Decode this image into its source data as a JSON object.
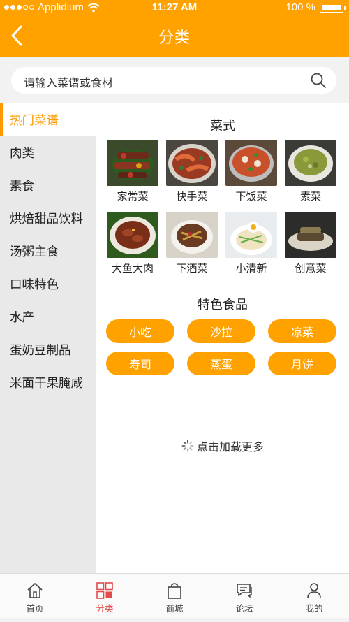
{
  "status_bar": {
    "carrier": "Applidium",
    "time": "11:27 AM",
    "battery": "100 %"
  },
  "nav": {
    "title": "分类"
  },
  "search": {
    "placeholder": "请输入菜谱或食材"
  },
  "sidebar": {
    "items": [
      {
        "label": "热门菜谱",
        "active": true
      },
      {
        "label": "肉类"
      },
      {
        "label": "素食"
      },
      {
        "label": "烘焙甜品饮料"
      },
      {
        "label": "汤粥主食"
      },
      {
        "label": "口味特色"
      },
      {
        "label": "水产"
      },
      {
        "label": "蛋奶豆制品"
      },
      {
        "label": "米面干果腌咸"
      }
    ]
  },
  "content": {
    "cuisine_title": "菜式",
    "cuisines": [
      {
        "label": "家常菜",
        "icon": "skewer-dish-photo"
      },
      {
        "label": "快手菜",
        "icon": "shrimp-dish-photo"
      },
      {
        "label": "下饭菜",
        "icon": "hotpot-photo"
      },
      {
        "label": "素菜",
        "icon": "vegetable-dish-photo"
      },
      {
        "label": "大鱼大肉",
        "icon": "braised-meat-photo"
      },
      {
        "label": "下酒菜",
        "icon": "snack-dish-photo"
      },
      {
        "label": "小清新",
        "icon": "noodle-egg-photo"
      },
      {
        "label": "创意菜",
        "icon": "creative-dish-photo"
      }
    ],
    "special_title": "特色食品",
    "specials": [
      "小吃",
      "沙拉",
      "凉菜",
      "寿司",
      "蒸蛋",
      "月饼"
    ],
    "load_more": "点击加载更多"
  },
  "tabbar": {
    "items": [
      {
        "label": "首页",
        "icon": "home-icon"
      },
      {
        "label": "分类",
        "icon": "category-grid-icon",
        "active": true
      },
      {
        "label": "商城",
        "icon": "shopping-bag-icon"
      },
      {
        "label": "论坛",
        "icon": "forum-chat-icon"
      },
      {
        "label": "我的",
        "icon": "profile-icon"
      }
    ]
  },
  "colors": {
    "accent": "#ffa200",
    "tab_active": "#e24b4b",
    "sidebar_bg": "#e9e9e9"
  }
}
